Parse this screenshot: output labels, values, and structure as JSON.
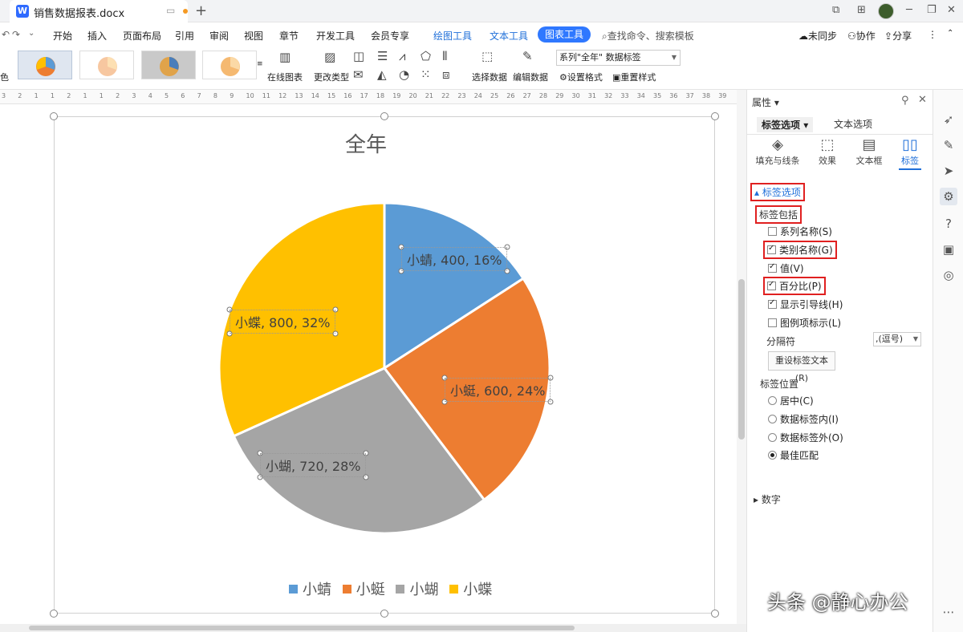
{
  "titlebar": {
    "doc_icon": "W",
    "doc_name": "销售数据报表.docx"
  },
  "menu": {
    "items": [
      "开始",
      "插入",
      "页面布局",
      "引用",
      "审阅",
      "视图",
      "章节",
      "开发工具",
      "会员专享"
    ],
    "context_tools": [
      "绘图工具",
      "文本工具"
    ],
    "active_tool": "图表工具",
    "search": "查找命令、搜索模板",
    "sync": "未同步",
    "collab": "协作",
    "share": "分享"
  },
  "ribbon": {
    "left_label": "色",
    "online_chart": "在线图表",
    "change_type": "更改类型",
    "select_data": "选择数据",
    "edit_data": "编辑数据",
    "series_select": "系列\"全年\" 数据标签",
    "set_format": "设置格式",
    "reset_style": "重置样式"
  },
  "ruler": {
    "marks": [
      "3",
      "2",
      "1",
      "1",
      "2",
      "1",
      "1",
      "2",
      "3",
      "4",
      "5",
      "6",
      "7",
      "8",
      "9",
      "10",
      "11",
      "12",
      "13",
      "14",
      "15",
      "16",
      "17",
      "18",
      "19",
      "20",
      "21",
      "22",
      "23",
      "24",
      "25",
      "26",
      "27",
      "28",
      "29",
      "30",
      "31",
      "32",
      "33",
      "34",
      "35",
      "36",
      "37",
      "38",
      "39"
    ]
  },
  "chart_data": {
    "type": "pie",
    "title": "全年",
    "categories": [
      "小蜻",
      "小蜓",
      "小蝴",
      "小蝶"
    ],
    "values": [
      400,
      600,
      720,
      800
    ],
    "percents": [
      "16%",
      "24%",
      "28%",
      "32%"
    ],
    "colors": [
      "#5b9bd5",
      "#ed7d31",
      "#a5a5a5",
      "#ffc000"
    ],
    "data_labels": [
      "小蜻, 400, 16%",
      "小蜓, 600, 24%",
      "小蝴, 720, 28%",
      "小蝶, 800, 32%"
    ],
    "legend_position": "bottom"
  },
  "panel": {
    "header": "属性",
    "tab_label_options": "标签选项",
    "tab_text_options": "文本选项",
    "icon_tabs": [
      "填充与线条",
      "效果",
      "文本框",
      "标签"
    ],
    "section_title": "标签选项",
    "includes_title": "标签包括",
    "includes": [
      {
        "label": "系列名称(S)",
        "checked": false
      },
      {
        "label": "类别名称(G)",
        "checked": true
      },
      {
        "label": "值(V)",
        "checked": true
      },
      {
        "label": "百分比(P)",
        "checked": true
      },
      {
        "label": "显示引导线(H)",
        "checked": true
      },
      {
        "label": "图例项标示(L)",
        "checked": false
      }
    ],
    "separator_label": "分隔符",
    "separator_value": ",(逗号)",
    "reset_text": "重设标签文本(R)",
    "position_title": "标签位置",
    "positions": [
      {
        "label": "居中(C)",
        "selected": false
      },
      {
        "label": "数据标签内(I)",
        "selected": false
      },
      {
        "label": "数据标签外(O)",
        "selected": false
      },
      {
        "label": "最佳匹配",
        "selected": true
      }
    ],
    "number_section": "数字"
  },
  "watermark": "头条 @静心办公"
}
